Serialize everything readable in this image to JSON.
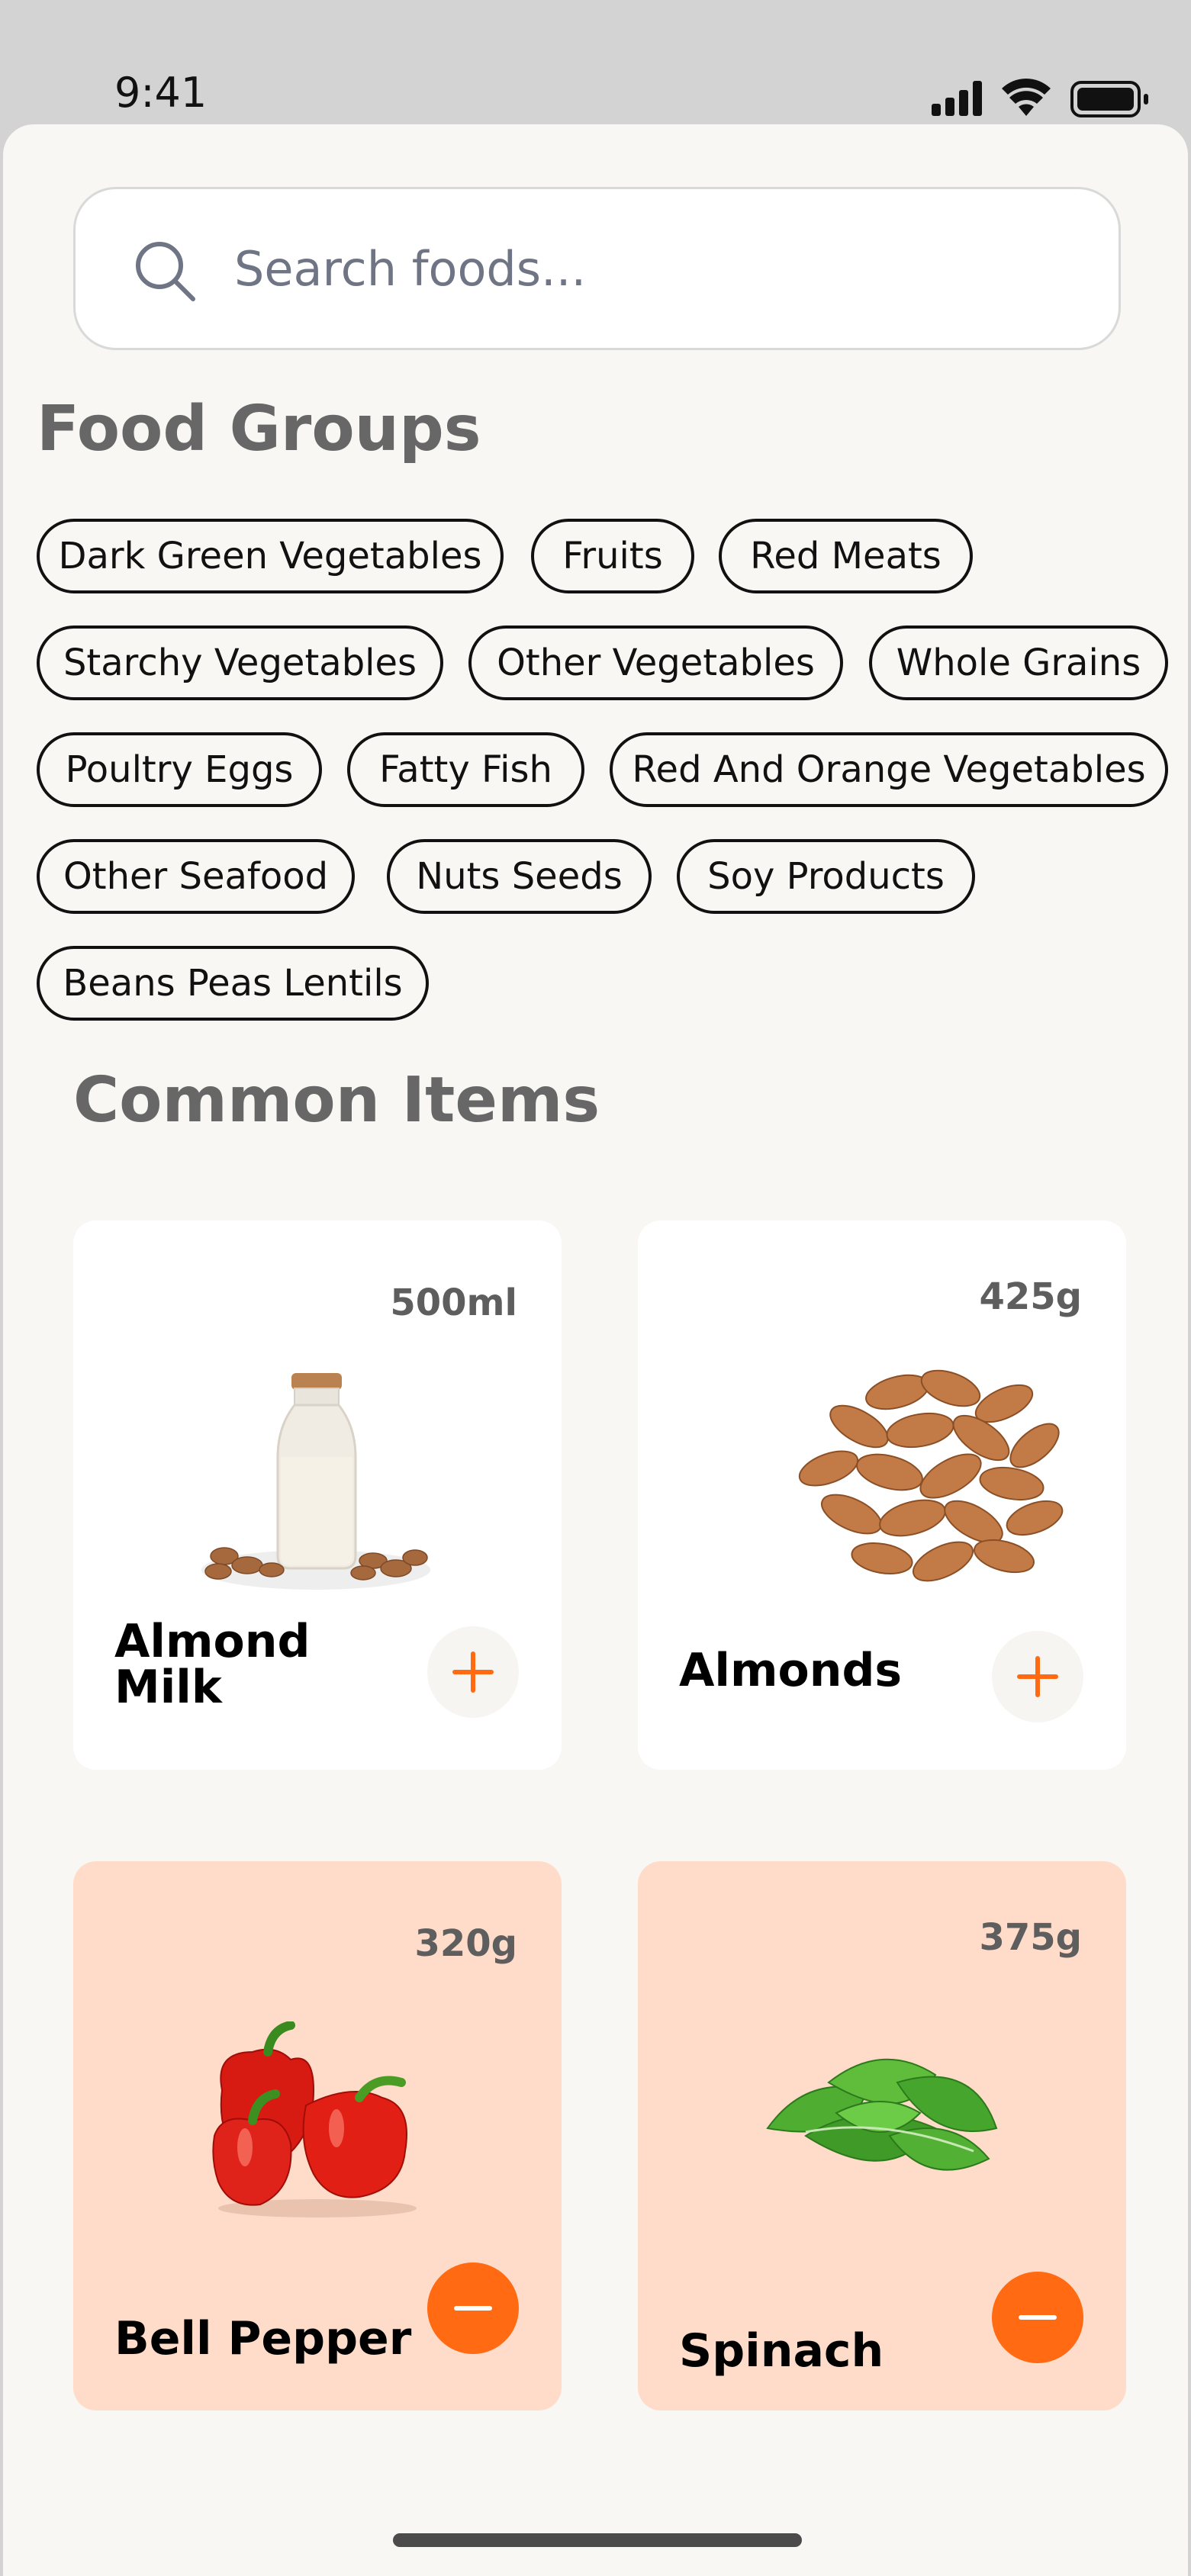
{
  "status": {
    "time": "9:41"
  },
  "search": {
    "placeholder": "Search foods..."
  },
  "food_groups": {
    "title": "Food Groups",
    "chips": [
      "Dark Green Vegetables",
      "Fruits",
      "Red Meats",
      "Starchy Vegetables",
      "Other Vegetables",
      "Whole Grains",
      "Poultry Eggs",
      "Fatty Fish",
      "Red And Orange Vegetables",
      "Other Seafood",
      "Nuts Seeds",
      "Soy Products",
      "Beans Peas Lentils"
    ]
  },
  "common_items": {
    "title": "Common Items",
    "items": [
      {
        "name": "Almond Milk",
        "weight": "500ml",
        "selected": false,
        "image": "almond-milk-bottle"
      },
      {
        "name": "Almonds",
        "weight": "425g",
        "selected": false,
        "image": "almonds-pile"
      },
      {
        "name": "Bell Pepper",
        "weight": "320g",
        "selected": true,
        "image": "red-bell-peppers"
      },
      {
        "name": "Spinach",
        "weight": "375g",
        "selected": true,
        "image": "spinach-leaves"
      }
    ]
  },
  "colors": {
    "accent": "#ff6a13",
    "selected_card": "#ffdcc9",
    "background": "#f8f7f4"
  }
}
